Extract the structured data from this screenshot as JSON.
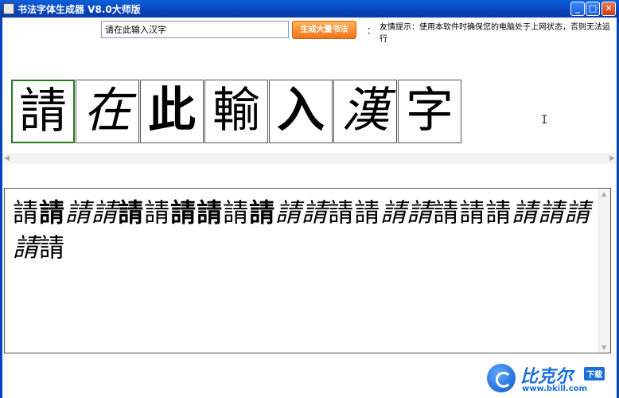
{
  "window": {
    "title": "书法字体生成器 V8.0大师版",
    "min_glyph": "_",
    "max_glyph": "□",
    "close_glyph": "✕"
  },
  "toolbar": {
    "input_value": "请在此输入汉字",
    "generate_label": "生成大量书法",
    "colon": "：",
    "tip": "友情提示：使用本软件时确保您的电脑处于上网状态，否则无法运行"
  },
  "preview_chars": [
    "請",
    "在",
    "此",
    "輸",
    "入",
    "漢",
    "字"
  ],
  "selected_index": 0,
  "style_samples": [
    "請",
    "請",
    "請",
    "請",
    "請",
    "請",
    "請",
    "請",
    "請",
    "請",
    "請",
    "請",
    "請",
    "請",
    "請",
    "請",
    "請",
    "請",
    "請",
    "請",
    "請",
    "請",
    "請",
    "請",
    "請"
  ],
  "logo": {
    "name": "比克尔",
    "badge": "下载",
    "url": "www.bkill.com"
  },
  "colors": {
    "titlebar": "#0743b8",
    "accent_button": "#f2731b",
    "selected_cell": "#2c7a1e",
    "logo": "#1a6fd8"
  }
}
